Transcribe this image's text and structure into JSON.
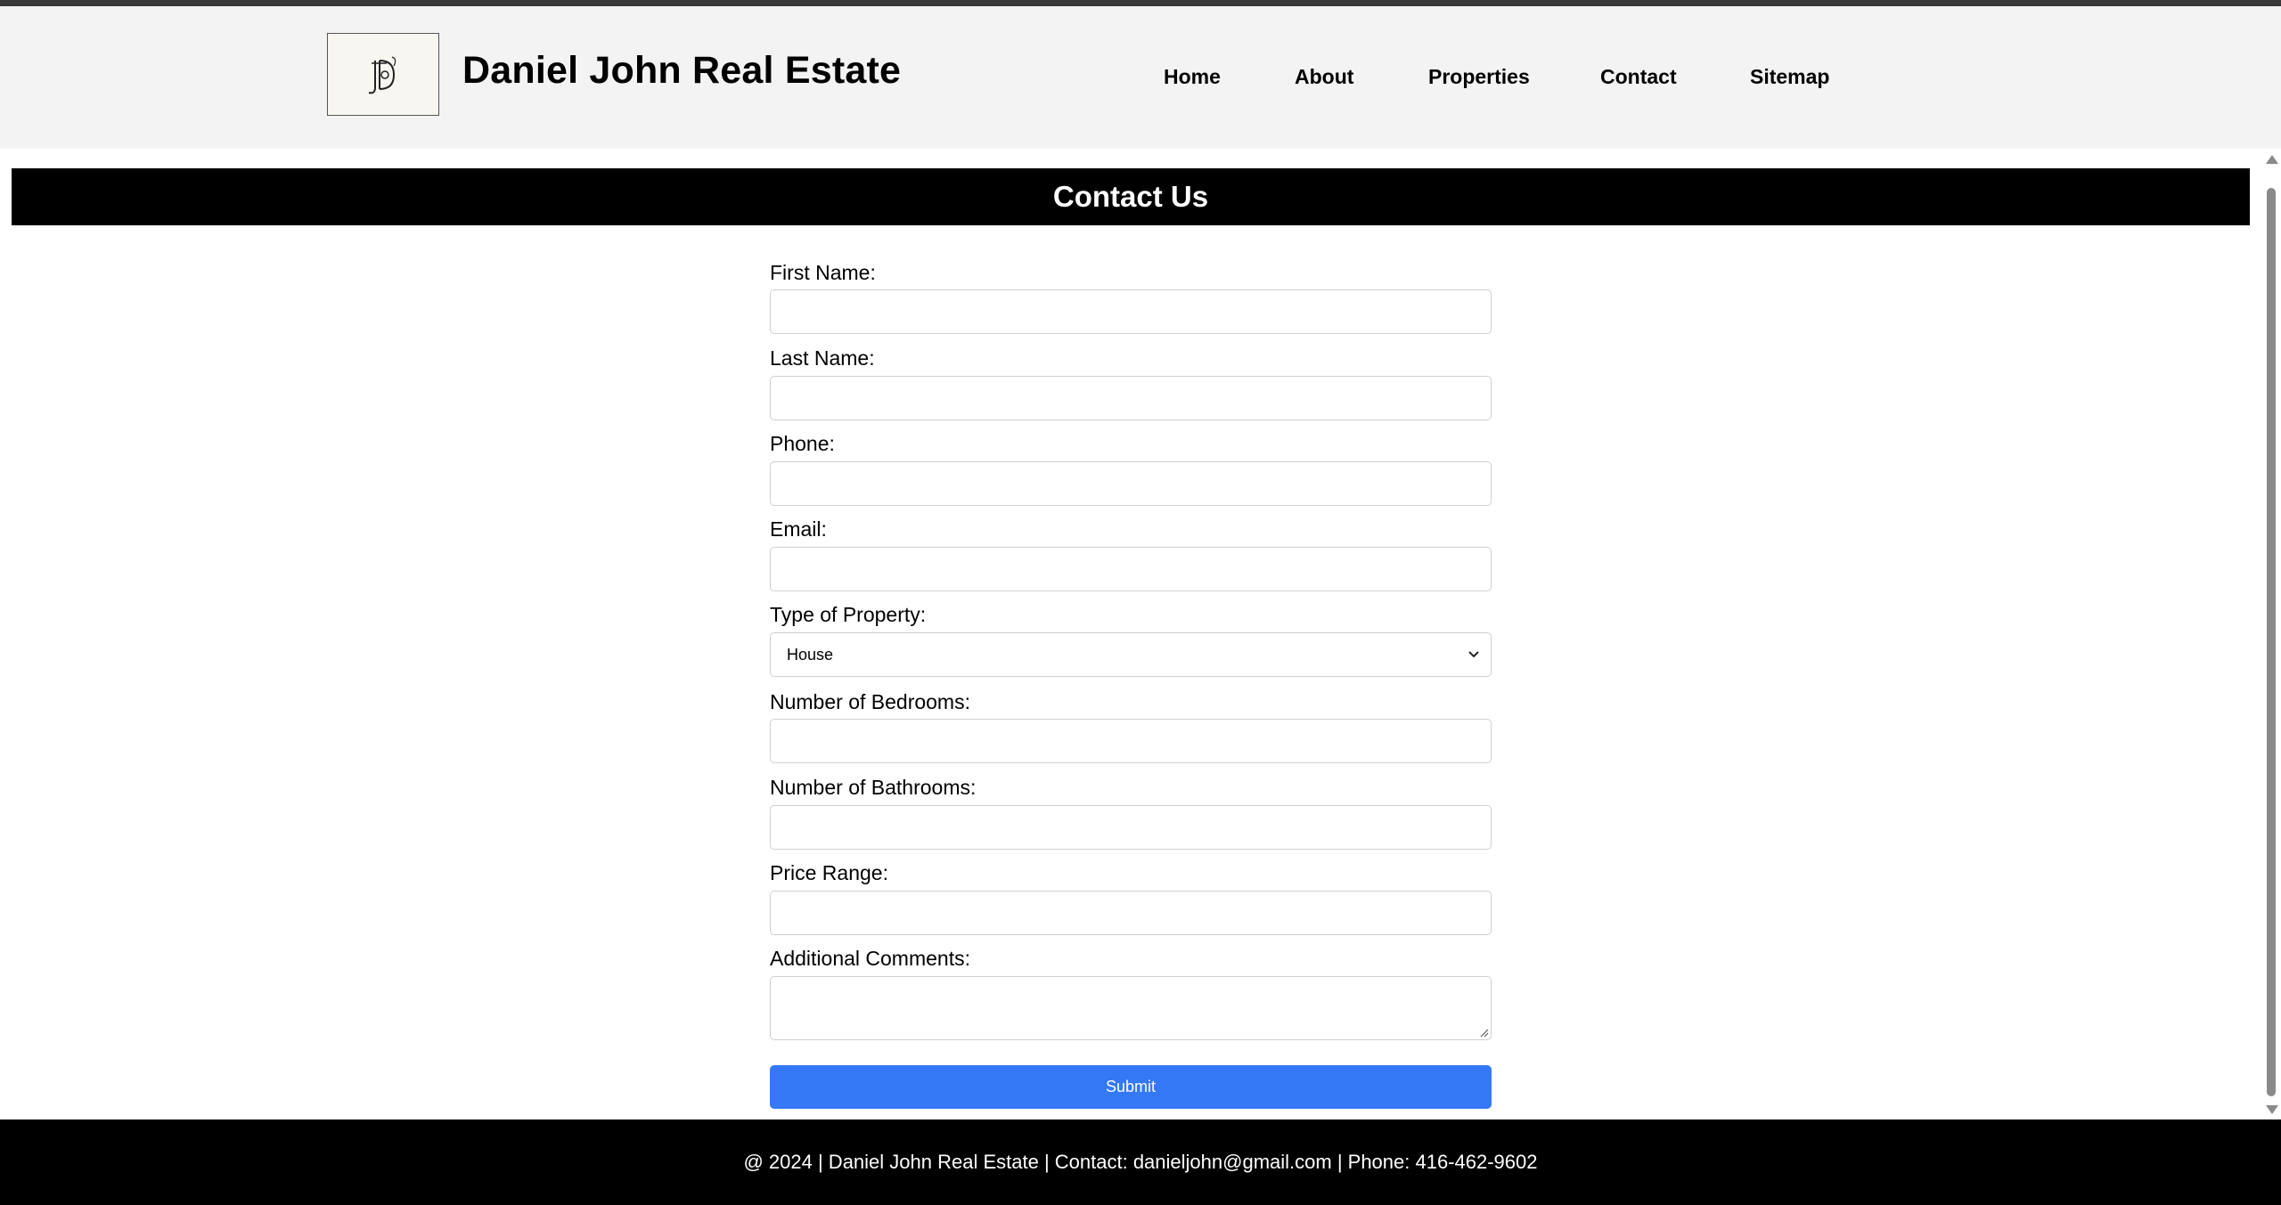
{
  "header": {
    "logo_letters": "JD",
    "site_title": "Daniel John Real Estate",
    "nav": [
      "Home",
      "About",
      "Properties",
      "Contact",
      "Sitemap"
    ]
  },
  "banner": {
    "title": "Contact Us"
  },
  "form": {
    "first_name_label": "First Name:",
    "first_name_value": "",
    "last_name_label": "Last Name:",
    "last_name_value": "",
    "phone_label": "Phone:",
    "phone_value": "",
    "email_label": "Email:",
    "email_value": "",
    "property_type_label": "Type of Property:",
    "property_type_selected": "House",
    "bedrooms_label": "Number of Bedrooms:",
    "bedrooms_value": "",
    "bathrooms_label": "Number of Bathrooms:",
    "bathrooms_value": "",
    "price_range_label": "Price Range:",
    "price_range_value": "",
    "comments_label": "Additional Comments:",
    "comments_value": "",
    "submit_label": "Submit"
  },
  "footer": {
    "text": "@ 2024 | Daniel John Real Estate | Contact: danieljohn@gmail.com | Phone: 416-462-9602"
  },
  "colors": {
    "header_bg": "#f3f3f3",
    "banner_bg": "#000000",
    "submit_bg": "#3478f6",
    "footer_bg": "#000000"
  }
}
